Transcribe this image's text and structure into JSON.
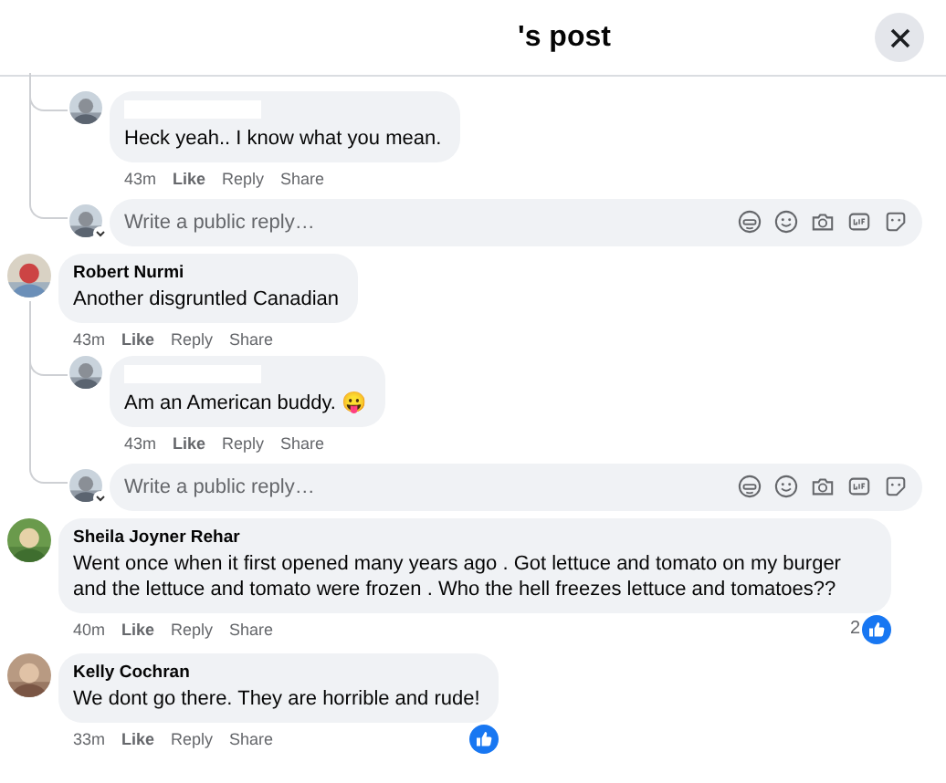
{
  "header": {
    "title": "'s post"
  },
  "items": [
    {
      "kind": "continued",
      "children": [
        {
          "kind": "reply",
          "name_redacted": true,
          "text": "Heck yeah.. I know what you mean.",
          "time": "43m",
          "actions": [
            "Like",
            "Reply",
            "Share"
          ]
        },
        {
          "kind": "reply_field",
          "placeholder": "Write a public reply…"
        }
      ]
    },
    {
      "kind": "comment",
      "name": "Robert Nurmi",
      "text": "Another disgruntled Canadian",
      "time": "43m",
      "actions": [
        "Like",
        "Reply",
        "Share"
      ],
      "children": [
        {
          "kind": "reply",
          "name_redacted": true,
          "text": "Am an American buddy. 😛",
          "time": "43m",
          "actions": [
            "Like",
            "Reply",
            "Share"
          ]
        },
        {
          "kind": "reply_field",
          "placeholder": "Write a public reply…"
        }
      ]
    },
    {
      "kind": "comment",
      "name": "Sheila Joyner Rehar",
      "text": "Went once when it first opened many years ago . Got lettuce and tomato on my burger and the lettuce and tomato were frozen . Who the hell freezes lettuce and tomatoes??",
      "time": "40m",
      "actions": [
        "Like",
        "Reply",
        "Share"
      ],
      "reacted": true,
      "reaction_count": "2"
    },
    {
      "kind": "comment",
      "name": "Kelly Cochran",
      "text": "We dont go there. They are horrible and rude!",
      "time": "33m",
      "actions": [
        "Like",
        "Reply",
        "Share"
      ],
      "reacted": true
    }
  ]
}
